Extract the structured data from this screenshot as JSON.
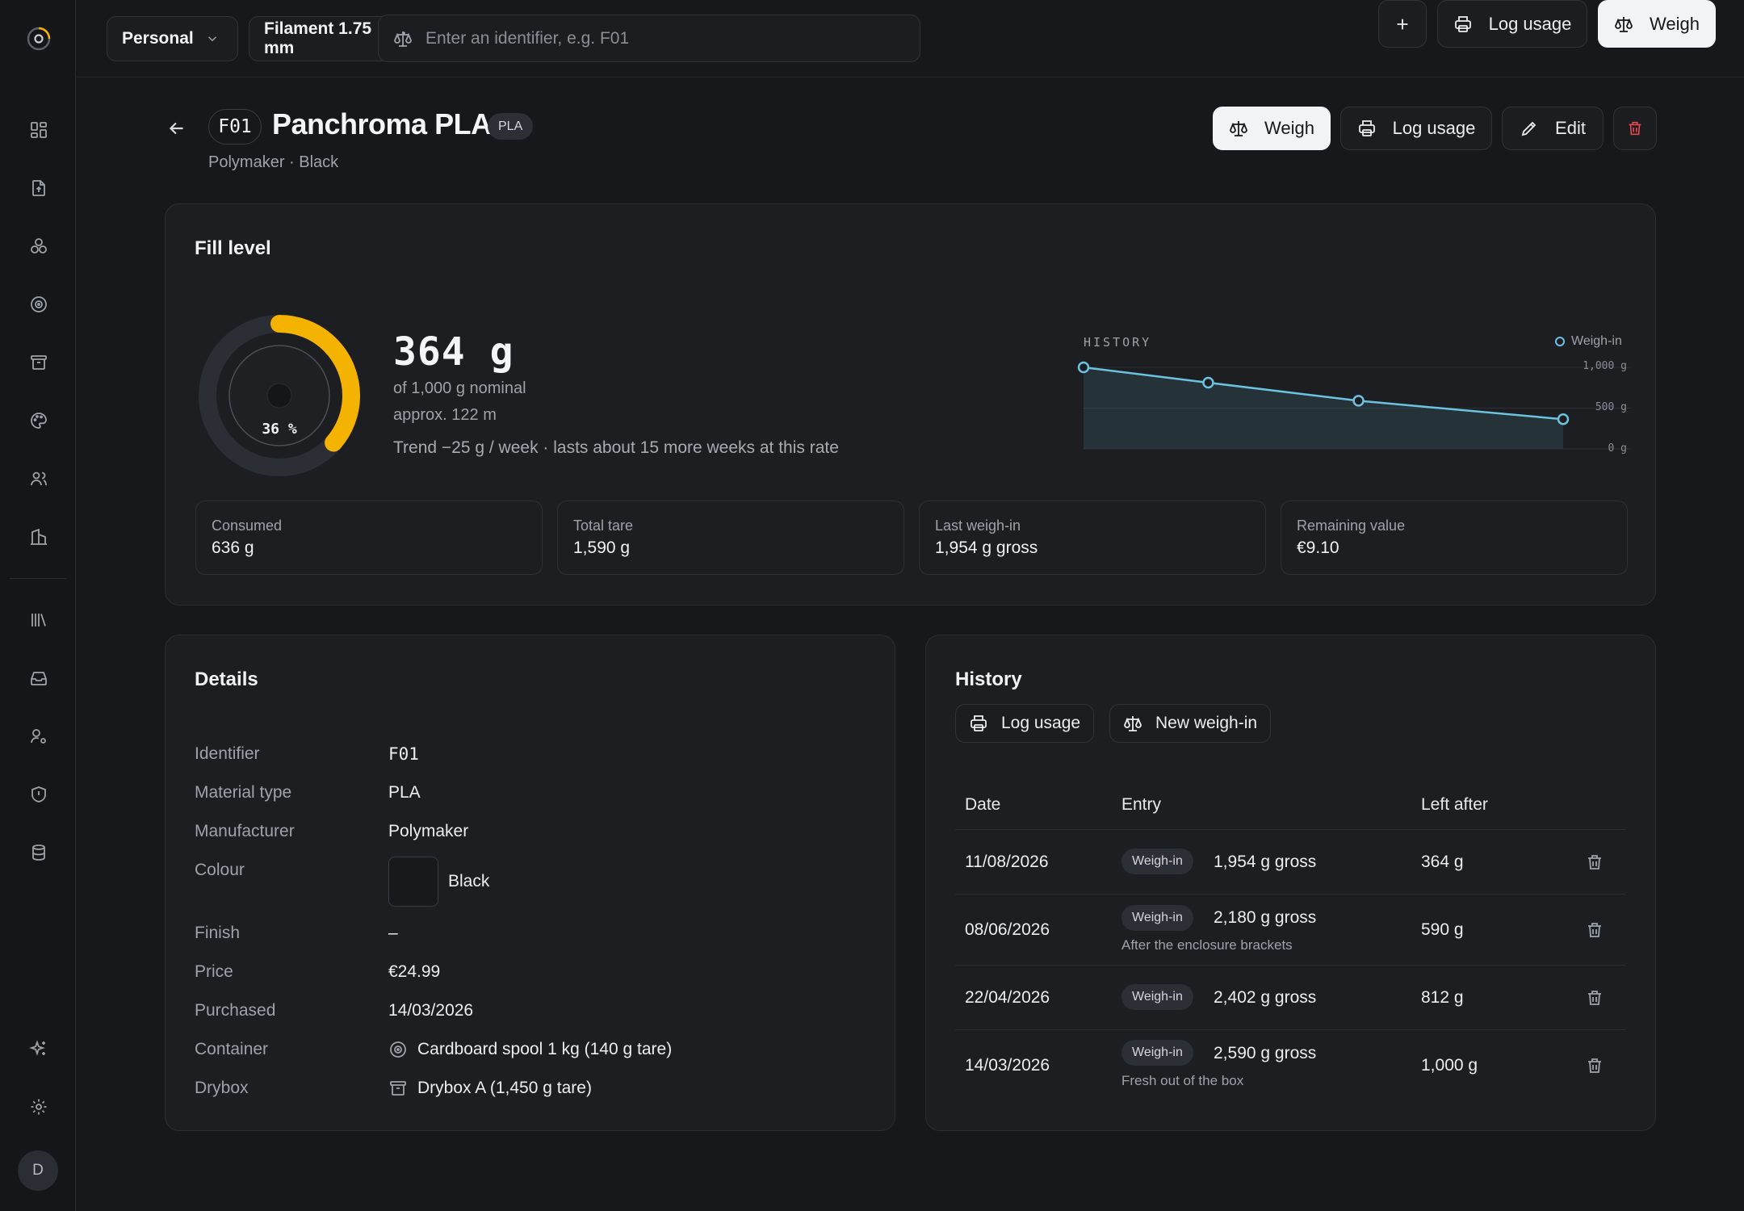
{
  "topbar": {
    "workspace": "Personal",
    "filament": "Filament 1.75 mm",
    "search_placeholder": "Enter an identifier, e.g. F01",
    "log_usage": "Log usage",
    "weigh": "Weigh"
  },
  "sidebar": {
    "icons": [
      "dashboard-icon",
      "upload-file-icon",
      "spools-icon",
      "filament-spool-icon",
      "archive-icon",
      "palette-icon",
      "users-icon",
      "building-icon",
      "library-icon",
      "inbox-icon",
      "user-settings-icon",
      "shield-icon",
      "database-icon",
      "sparkle-icon",
      "gear-icon"
    ],
    "avatar": "D"
  },
  "header": {
    "identifier": "F01",
    "title": "Panchroma PLA",
    "type": "PLA",
    "subtitle": "Polymaker · Black",
    "weigh": "Weigh",
    "log_usage": "Log usage",
    "edit": "Edit"
  },
  "fill": {
    "title": "Fill level",
    "percent_label": "36 %",
    "fraction": 0.364,
    "grams": "364 g",
    "nominal": "of 1,000 g nominal",
    "length": "approx. 122 m",
    "trend": "Trend −25 g / week · lasts about 15 more weeks at this rate",
    "history_label": "HISTORY",
    "legend": "Weigh-in",
    "accent": "#f5b301",
    "line_color": "#6cc3e0",
    "stats": [
      {
        "label": "Consumed",
        "value": "636 g"
      },
      {
        "label": "Total tare",
        "value": "1,590 g"
      },
      {
        "label": "Last weigh-in",
        "value": "1,954 g gross"
      },
      {
        "label": "Remaining value",
        "value": "€9.10"
      }
    ]
  },
  "chart_data": {
    "type": "area",
    "x": [
      "14/03/2026",
      "22/04/2026",
      "08/06/2026",
      "11/08/2026"
    ],
    "series": [
      {
        "name": "Weigh-in",
        "values": [
          1000,
          812,
          590,
          364
        ]
      }
    ],
    "yticks": [
      "1,000 g",
      "500 g",
      "0 g"
    ],
    "ylim": [
      0,
      1000
    ],
    "legend": "top-right",
    "grid": true
  },
  "details": {
    "title": "Details",
    "rows": [
      {
        "label": "Identifier",
        "value": "F01"
      },
      {
        "label": "Material type",
        "value": "PLA"
      },
      {
        "label": "Manufacturer",
        "value": "Polymaker"
      },
      {
        "label": "Colour",
        "value": "Black"
      },
      {
        "label": "Finish",
        "value": "–"
      },
      {
        "label": "Price",
        "value": "€24.99"
      },
      {
        "label": "Purchased",
        "value": "14/03/2026"
      },
      {
        "label": "Container",
        "value": "Cardboard spool 1 kg (140 g tare)"
      },
      {
        "label": "Drybox",
        "value": "Drybox A (1,450 g tare)"
      }
    ],
    "colour_swatch": "#18191b"
  },
  "history": {
    "title": "History",
    "log_usage": "Log usage",
    "new_weigh_in": "New weigh-in",
    "columns": [
      "Date",
      "Entry",
      "Left after"
    ],
    "rows": [
      {
        "date": "11/08/2026",
        "badge": "Weigh-in",
        "entry": "1,954 g gross",
        "note": "",
        "left": "364 g"
      },
      {
        "date": "08/06/2026",
        "badge": "Weigh-in",
        "entry": "2,180 g gross",
        "note": "After the enclosure brackets",
        "left": "590 g"
      },
      {
        "date": "22/04/2026",
        "badge": "Weigh-in",
        "entry": "2,402 g gross",
        "note": "",
        "left": "812 g"
      },
      {
        "date": "14/03/2026",
        "badge": "Weigh-in",
        "entry": "2,590 g gross",
        "note": "Fresh out of the box",
        "left": "1,000 g"
      }
    ]
  }
}
